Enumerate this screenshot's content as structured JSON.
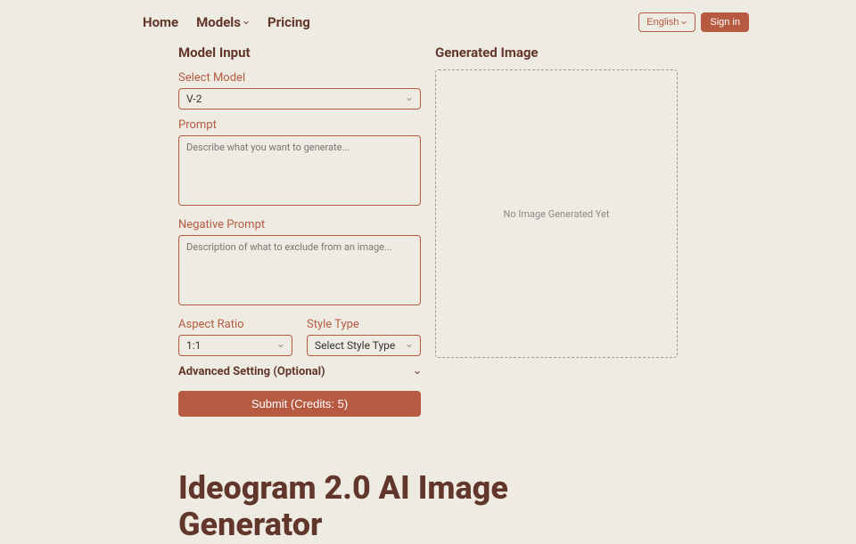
{
  "nav": {
    "home": "Home",
    "models": "Models",
    "pricing": "Pricing"
  },
  "header": {
    "language": "English",
    "signin": "Sign in"
  },
  "form": {
    "sectionTitle": "Model Input",
    "selectModelLabel": "Select Model",
    "selectModelValue": "V-2",
    "promptLabel": "Prompt",
    "promptPlaceholder": "Describe what you want to generate...",
    "negPromptLabel": "Negative Prompt",
    "negPromptPlaceholder": "Description of what to exclude from an image...",
    "aspectLabel": "Aspect Ratio",
    "aspectValue": "1:1",
    "styleLabel": "Style Type",
    "styleValue": "Select Style Type",
    "advanced": "Advanced Setting (Optional)",
    "submit": "Submit (Credits: 5)"
  },
  "output": {
    "sectionTitle": "Generated Image",
    "placeholder": "No Image Generated Yet"
  },
  "hero": {
    "title": "Ideogram 2.0 AI Image Generator"
  }
}
